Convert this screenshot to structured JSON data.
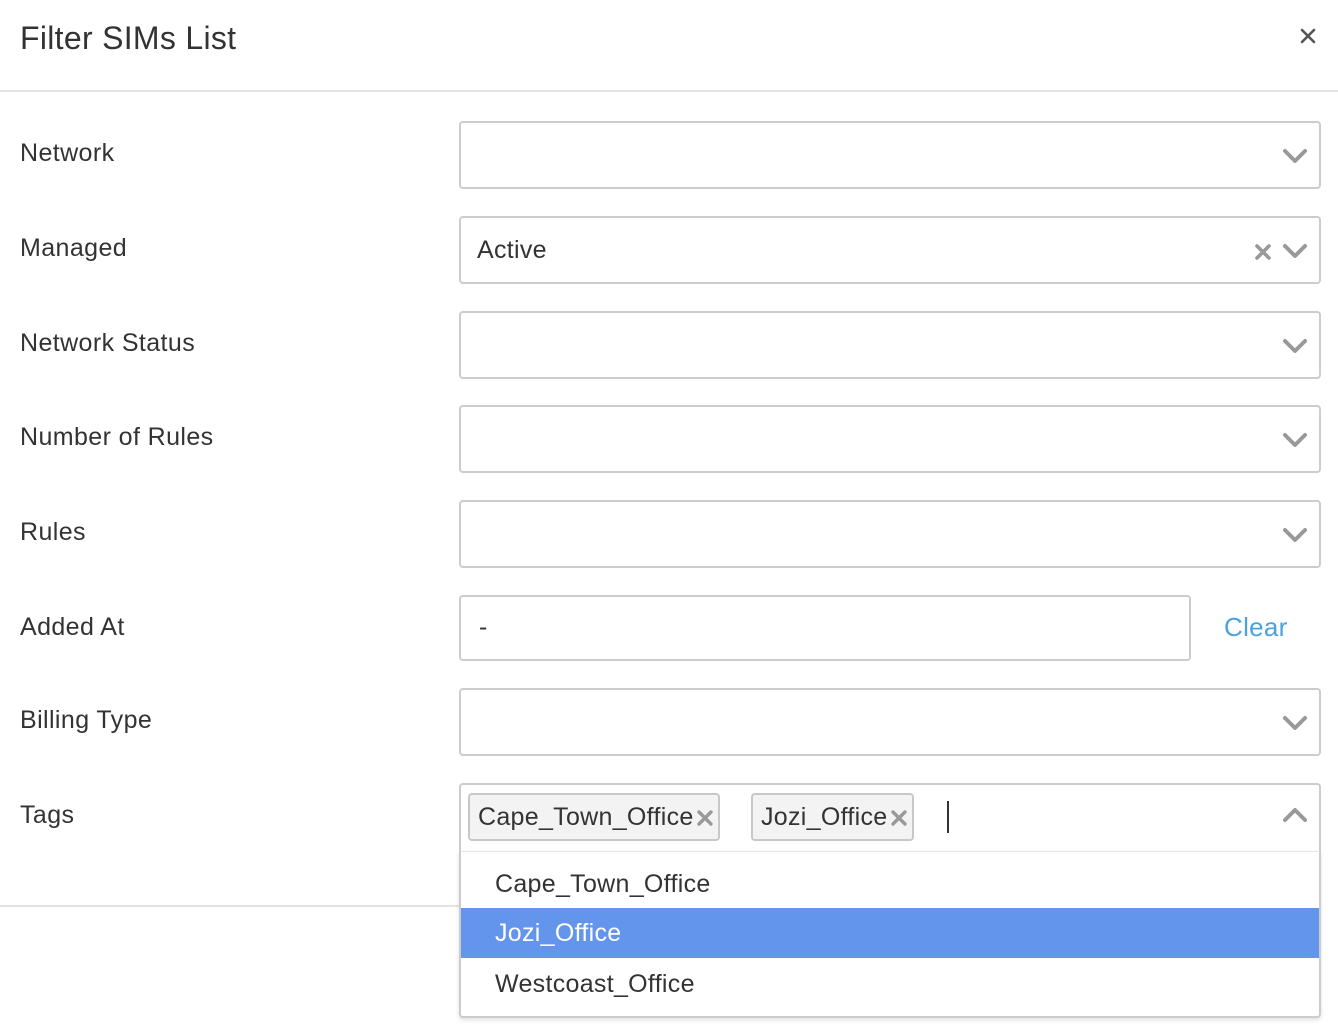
{
  "dialog": {
    "title": "Filter SIMs List",
    "close_icon": "close-icon"
  },
  "fields": {
    "network": {
      "label": "Network",
      "value": ""
    },
    "managed": {
      "label": "Managed",
      "value": "Active"
    },
    "network_status": {
      "label": "Network Status",
      "value": ""
    },
    "number_of_rules": {
      "label": "Number of Rules",
      "value": ""
    },
    "rules": {
      "label": "Rules",
      "value": ""
    },
    "added_at": {
      "label": "Added At",
      "value": "-",
      "clear_label": "Clear"
    },
    "billing_type": {
      "label": "Billing Type",
      "value": ""
    },
    "tags": {
      "label": "Tags",
      "selected": [
        "Cape_Town_Office",
        "Jozi_Office"
      ],
      "options": [
        "Cape_Town_Office",
        "Jozi_Office",
        "Westcoast_Office"
      ],
      "highlighted_option": "Jozi_Office"
    }
  },
  "colors": {
    "highlight": "#6495ed",
    "link": "#4aa3df",
    "border": "#cccccc",
    "icon": "#999999"
  }
}
